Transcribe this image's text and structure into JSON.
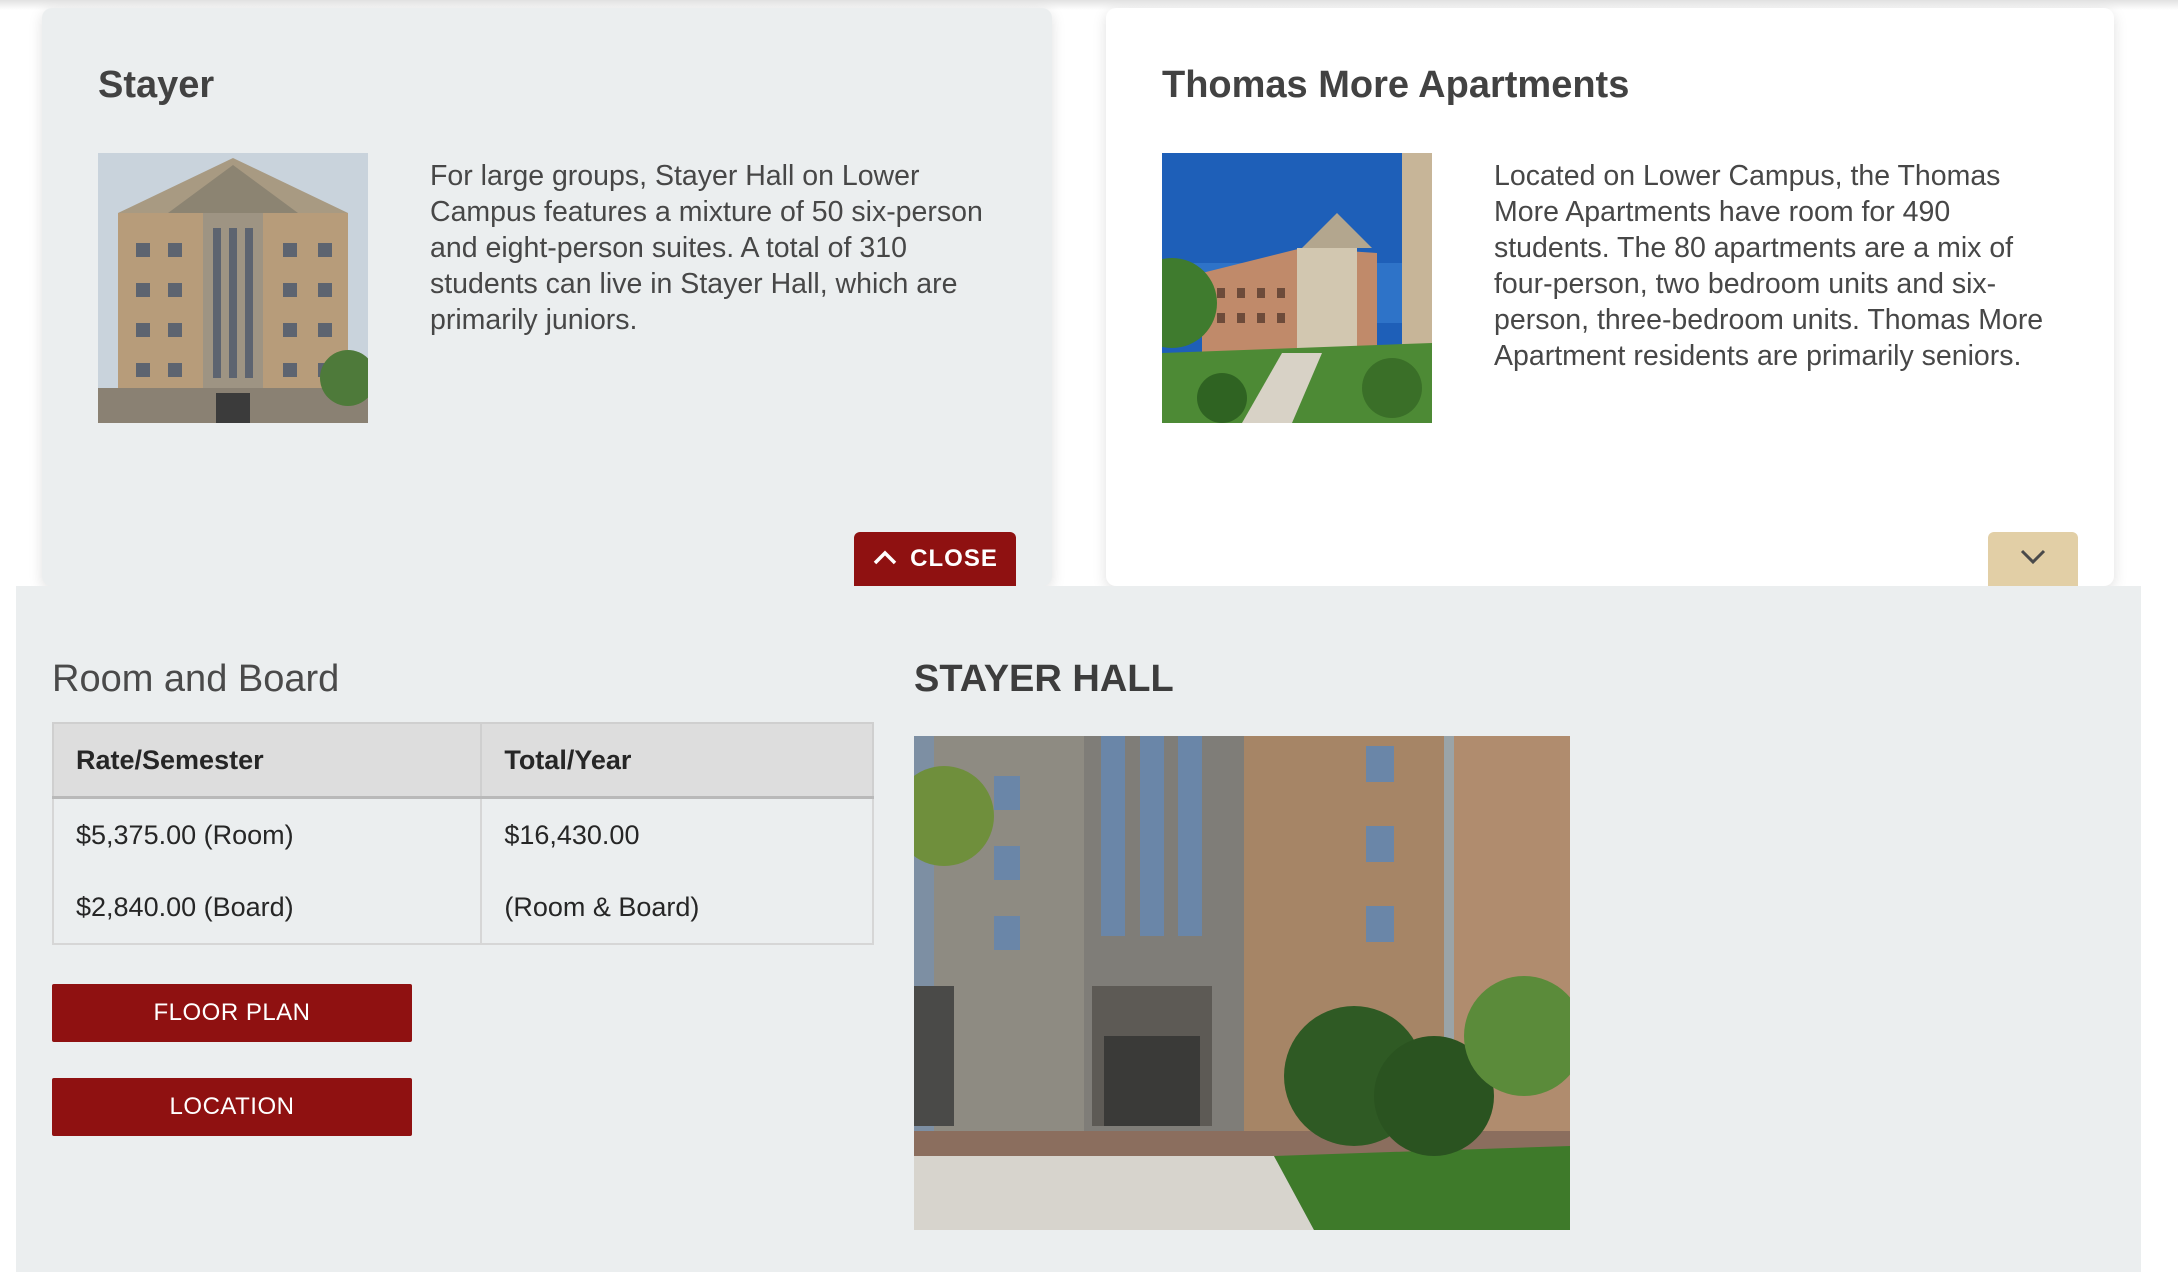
{
  "cards": [
    {
      "title": "Stayer",
      "description": "For large groups, Stayer Hall on Lower Campus features a mixture of 50 six-person and eight-person suites. A total of 310 students can live in Stayer Hall, which are primarily juniors.",
      "toggle_label": "CLOSE",
      "toggle_icon": "chevron-up-icon",
      "state": "expanded"
    },
    {
      "title": "Thomas More Apartments",
      "description": "Located on Lower Campus, the Thomas More Apartments have room for 490 students. The 80 apartments are a mix of four-person, two bedroom units and six-person, three-bedroom units. Thomas More Apartment residents are primarily seniors.",
      "toggle_icon": "chevron-down-icon",
      "state": "collapsed"
    }
  ],
  "detail": {
    "section_title": "Room and Board",
    "table": {
      "headers": [
        "Rate/Semester",
        "Total/Year"
      ],
      "rows": [
        [
          "$5,375.00 (Room)",
          "$16,430.00"
        ],
        [
          "$2,840.00 (Board)",
          "(Room & Board)"
        ]
      ]
    },
    "buttons": {
      "floor_plan": "FLOOR PLAN",
      "location": "LOCATION"
    },
    "hall_title": "STAYER HALL"
  },
  "colors": {
    "brand_red": "#8f1111",
    "expand_tan": "#e2cfa6",
    "panel_gray": "#ebeeef"
  }
}
